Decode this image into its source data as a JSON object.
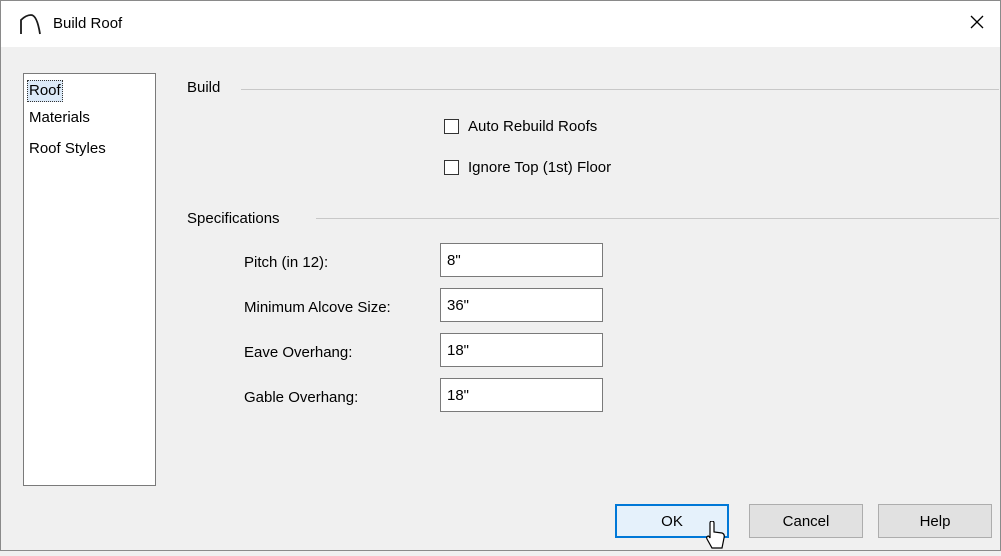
{
  "window": {
    "title": "Build Roof",
    "icon": "roof-arc-icon",
    "close_glyph": "✕"
  },
  "nav": {
    "items": [
      {
        "label": "Roof",
        "selected": true
      },
      {
        "label": "Materials",
        "selected": false
      },
      {
        "label": "Roof Styles",
        "selected": false
      }
    ]
  },
  "build_group": {
    "label": "Build",
    "auto_rebuild": {
      "label": "Auto Rebuild Roofs",
      "checked": false
    },
    "ignore_top_floor": {
      "label": "Ignore Top (1st) Floor",
      "checked": false
    }
  },
  "specifications": {
    "label": "Specifications",
    "fields": [
      {
        "label": "Pitch (in 12):",
        "value": "8\""
      },
      {
        "label": "Minimum Alcove Size:",
        "value": "36\""
      },
      {
        "label": "Eave Overhang:",
        "value": "18\""
      },
      {
        "label": "Gable Overhang:",
        "value": "18\""
      }
    ]
  },
  "buttons": {
    "ok": "OK",
    "cancel": "Cancel",
    "help": "Help"
  },
  "colors": {
    "default_button_border": "#0078d7",
    "selection": "#dceaf8"
  }
}
